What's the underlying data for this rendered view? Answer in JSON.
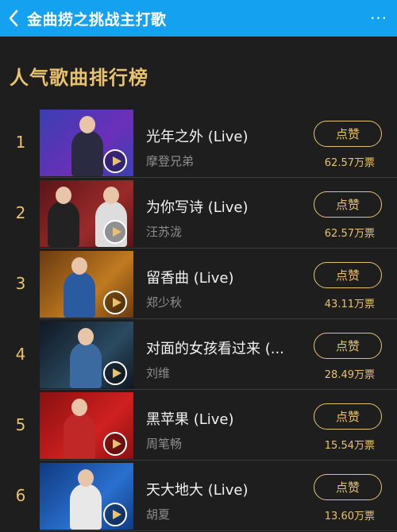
{
  "header": {
    "back_icon": "chevron-left-icon",
    "title": "金曲捞之挑战主打歌",
    "more_label": "···"
  },
  "section": {
    "title": "人气歌曲排行榜"
  },
  "list": [
    {
      "rank": "1",
      "title": "光年之外 (Live)",
      "artist": "摩登兄弟",
      "like_label": "点赞",
      "votes": "62.57万票",
      "thumb_colors": [
        "#3a3fb0",
        "#6b2fb8"
      ]
    },
    {
      "rank": "2",
      "title": "为你写诗 (Live)",
      "artist": "汪苏泷",
      "like_label": "点赞",
      "votes": "62.57万票",
      "thumb_colors": [
        "#5a1418",
        "#9a2a2a"
      ]
    },
    {
      "rank": "3",
      "title": "留香曲 (Live)",
      "artist": "郑少秋",
      "like_label": "点赞",
      "votes": "43.11万票",
      "thumb_colors": [
        "#6a3a10",
        "#c07a20"
      ]
    },
    {
      "rank": "4",
      "title": "对面的女孩看过来 (...",
      "artist": "刘维",
      "like_label": "点赞",
      "votes": "28.49万票",
      "thumb_colors": [
        "#101822",
        "#2a4a60"
      ]
    },
    {
      "rank": "5",
      "title": "黑苹果 (Live)",
      "artist": "周笔畅",
      "like_label": "点赞",
      "votes": "15.54万票",
      "thumb_colors": [
        "#8a1010",
        "#d02020"
      ]
    },
    {
      "rank": "6",
      "title": "天大地大 (Live)",
      "artist": "胡夏",
      "like_label": "点赞",
      "votes": "13.60万票",
      "thumb_colors": [
        "#103a80",
        "#2a70d0"
      ]
    }
  ]
}
